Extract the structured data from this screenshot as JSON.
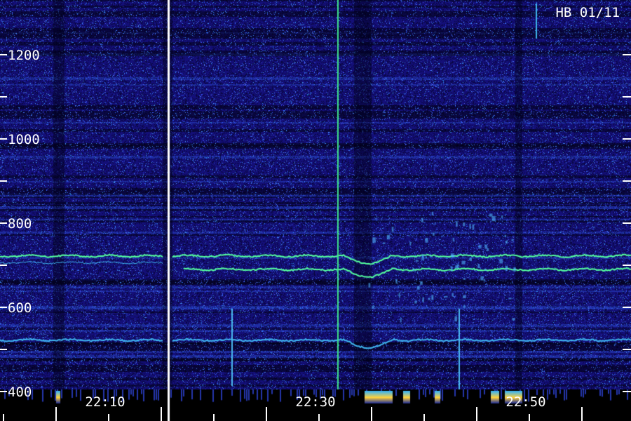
{
  "chart_data": {
    "type": "heatmap",
    "title": "HB 01/11",
    "xlabel": "",
    "ylabel": "",
    "y_ticks": [
      400,
      600,
      800,
      1000,
      1200
    ],
    "y_tick_labels": [
      "400",
      "600",
      "800",
      "1000",
      "1200"
    ],
    "x_tick_labels": [
      "22:10",
      "22:30",
      "22:50"
    ],
    "ylim": [
      300,
      1250
    ],
    "time_range": [
      "22:00",
      "23:00"
    ],
    "grid": false,
    "colors": {
      "background": "#140f78",
      "band_strong": "#54ff9f",
      "band_medium": "#3fb6f0",
      "burst": "#ffd23c",
      "axis": "#ffffff"
    },
    "series": [
      {
        "name": "",
        "freq_hz": 722,
        "intensity": "high"
      },
      {
        "name": "",
        "freq_hz": 690,
        "intensity": "high"
      },
      {
        "name": "",
        "freq_hz": 522,
        "intensity": "medium"
      }
    ]
  }
}
